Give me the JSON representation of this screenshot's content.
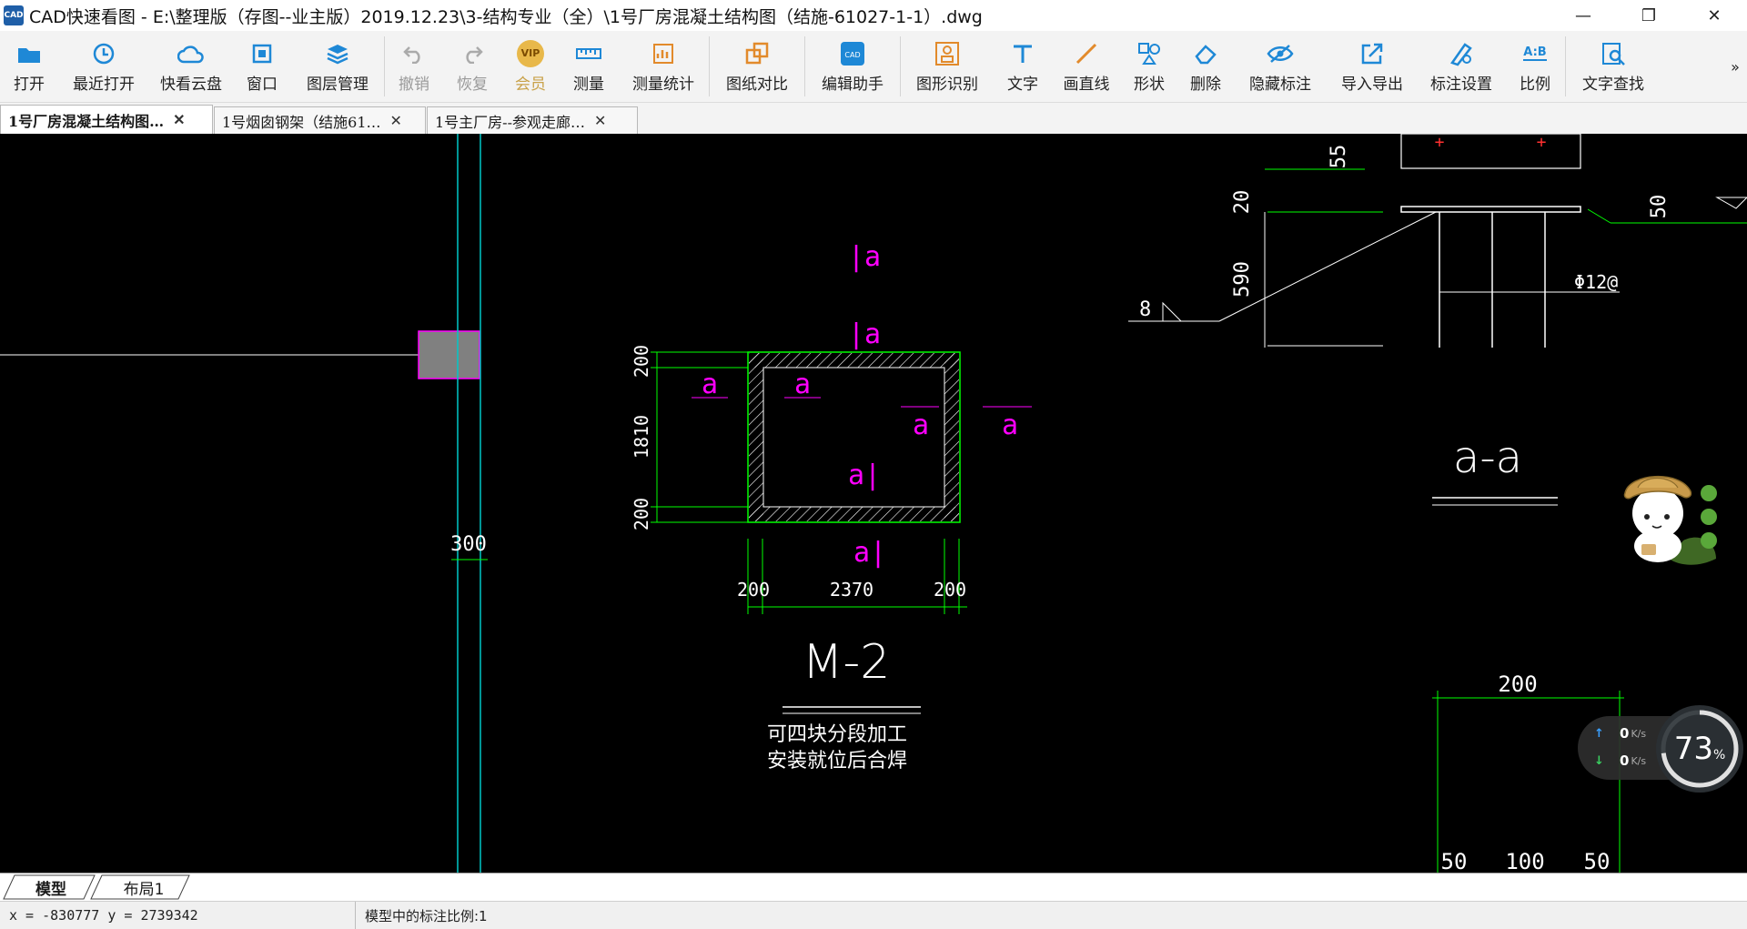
{
  "window": {
    "logo_text": "CAD",
    "title": "CAD快速看图 - E:\\整理版（存图--业主版）2019.12.23\\3-结构专业（全）\\1号厂房混凝土结构图（结施-61027-1-1）.dwg",
    "minimize": "—",
    "restore": "❐",
    "close": "✕"
  },
  "toolbar": {
    "items": [
      {
        "label": "打开",
        "icon": "open-folder-icon"
      },
      {
        "label": "最近打开",
        "icon": "recent-clock-icon"
      },
      {
        "label": "快看云盘",
        "icon": "cloud-icon"
      },
      {
        "label": "窗口",
        "icon": "window-icon"
      },
      {
        "label": "图层管理",
        "icon": "layers-icon"
      },
      {
        "label": "撤销",
        "icon": "undo-icon"
      },
      {
        "label": "恢复",
        "icon": "redo-icon"
      },
      {
        "label": "会员",
        "icon": "vip-icon",
        "badge": "VIP"
      },
      {
        "label": "测量",
        "icon": "ruler-icon"
      },
      {
        "label": "测量统计",
        "icon": "measure-stats-icon"
      },
      {
        "label": "图纸对比",
        "icon": "compare-icon"
      },
      {
        "label": "编辑助手",
        "icon": "edit-assistant-icon"
      },
      {
        "label": "图形识别",
        "icon": "shape-recognize-icon"
      },
      {
        "label": "文字",
        "icon": "text-icon"
      },
      {
        "label": "画直线",
        "icon": "line-icon"
      },
      {
        "label": "形状",
        "icon": "shapes-icon"
      },
      {
        "label": "删除",
        "icon": "eraser-icon"
      },
      {
        "label": "隐藏标注",
        "icon": "hide-eye-icon"
      },
      {
        "label": "导入导出",
        "icon": "import-export-icon"
      },
      {
        "label": "标注设置",
        "icon": "annotation-settings-icon"
      },
      {
        "label": "比例",
        "icon": "scale-icon",
        "badge": "A:B"
      },
      {
        "label": "文字查找",
        "icon": "text-search-icon"
      }
    ],
    "overflow": "»"
  },
  "tabs": [
    {
      "label": "1号厂房混凝土结构图…",
      "active": true
    },
    {
      "label": "1号烟囱钢架（结施61…",
      "active": false
    },
    {
      "label": "1号主厂房--参观走廊…",
      "active": false
    }
  ],
  "tab_close": "✕",
  "drawing": {
    "dims": {
      "d55": "55",
      "d20": "20",
      "d50": "50",
      "d590": "590",
      "d8": "8",
      "d200a": "200",
      "d1810": "1810",
      "d200b": "200",
      "d300": "300",
      "b200a": "200",
      "b2370": "2370",
      "b200b": "200",
      "r200": "200",
      "r50a": "50",
      "r100": "100",
      "r50b": "50",
      "phi": "Φ12@"
    },
    "section_marks": {
      "a1": "|a",
      "a2": "|a",
      "a3": "a",
      "a4": "a",
      "a5": "a|",
      "a6": "a",
      "a7": "a",
      "a8": "a|"
    },
    "section_title": "a-a",
    "m2_title": "M-2",
    "m2_note1": "可四块分段加工",
    "m2_note2": "安装就位后合焊"
  },
  "network": {
    "up": "0",
    "down": "0",
    "unit": "K/s",
    "percent": "73",
    "percent_sign": "%"
  },
  "layout_tabs": {
    "model": "模型",
    "layout1": "布局1"
  },
  "status": {
    "coords": "x = -830777  y = 2739342",
    "scale": "模型中的标注比例:1"
  },
  "colors": {
    "canvas_bg": "#000000",
    "dim_green": "#00ff00",
    "section_magenta": "#ff00ff",
    "axis_cyan": "#00c8c8",
    "line_white": "#ffffff"
  }
}
